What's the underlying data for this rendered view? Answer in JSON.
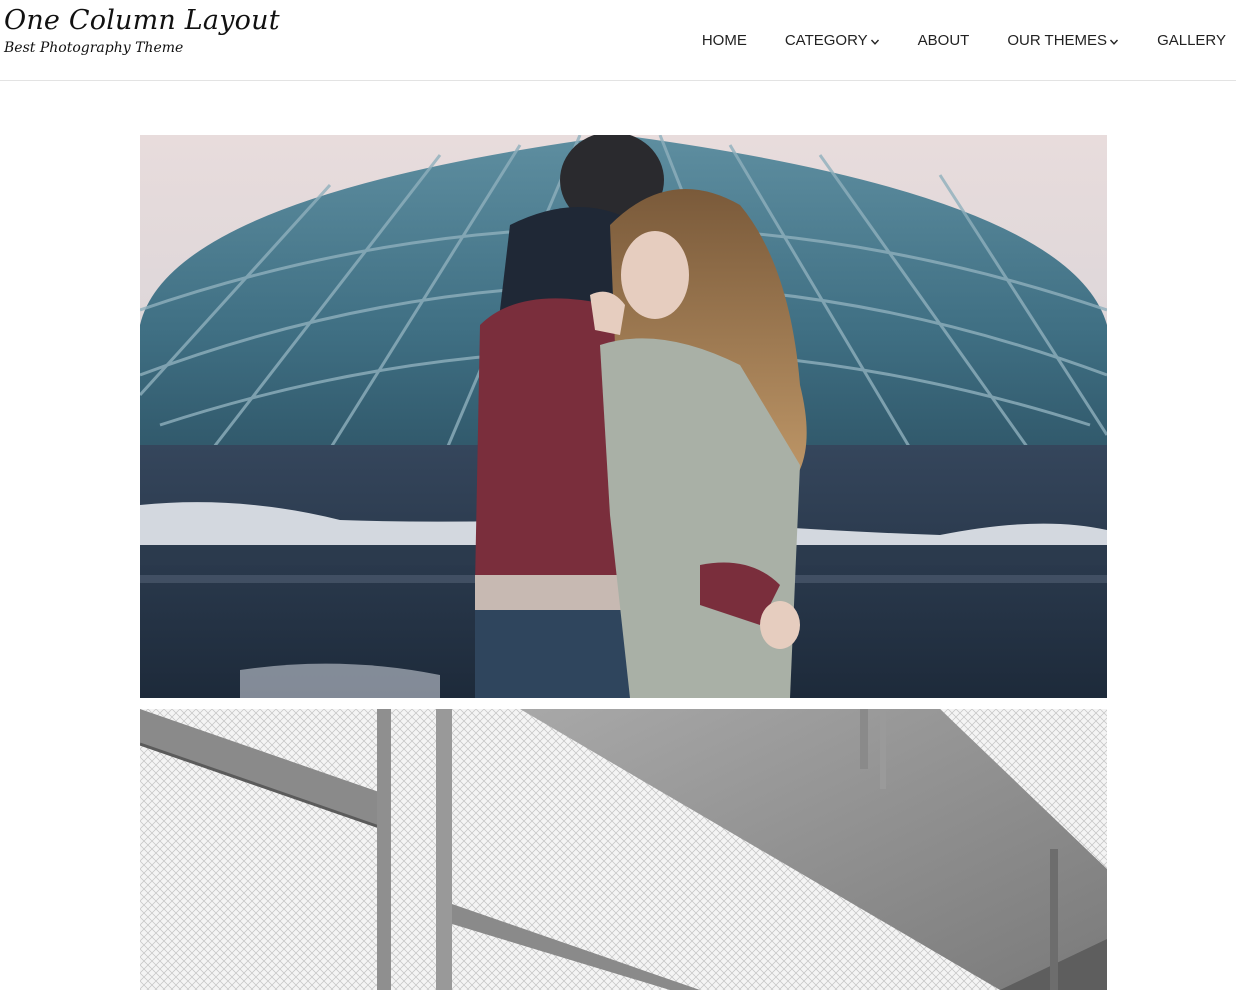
{
  "site": {
    "title": "One Column Layout",
    "tagline": "Best Photography Theme"
  },
  "nav": {
    "items": [
      {
        "label": "HOME",
        "has_dropdown": false
      },
      {
        "label": "CATEGORY",
        "has_dropdown": true
      },
      {
        "label": "ABOUT",
        "has_dropdown": false
      },
      {
        "label": "OUR THEMES",
        "has_dropdown": true
      },
      {
        "label": "GALLERY",
        "has_dropdown": false
      }
    ]
  },
  "gallery": {
    "photos": [
      {
        "subject": "couple embracing in front of glass dome"
      },
      {
        "subject": "black and white fence and metal beams"
      }
    ]
  },
  "colors": {
    "text": "#222222",
    "header_border": "#e3e3e3",
    "background": "#ffffff"
  }
}
